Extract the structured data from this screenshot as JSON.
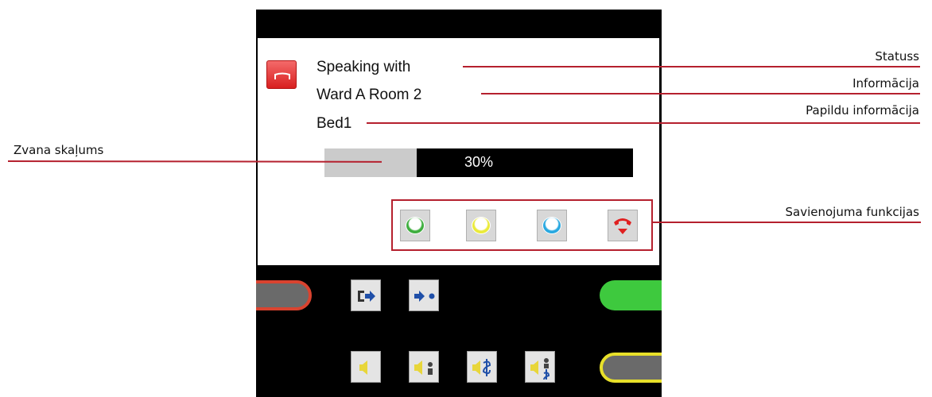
{
  "screen": {
    "status_text": "Speaking with",
    "info_text": "Ward A Room 2",
    "extra_info_text": "Bed1"
  },
  "volume": {
    "level_percent": 30,
    "label": "30%"
  },
  "connection_functions": [
    {
      "name": "green-call",
      "color": "#3fae3f"
    },
    {
      "name": "yellow-call",
      "color": "#eaea3a"
    },
    {
      "name": "blue-call",
      "color": "#29a8e0"
    },
    {
      "name": "hang-up",
      "color": "#e02020"
    }
  ],
  "annotations": {
    "status": "Statuss",
    "information": "Informācija",
    "extra_information": "Papildu informācija",
    "ring_volume": "Zvana skaļums",
    "connection_functions": "Savienojuma funkcijas"
  },
  "colors": {
    "accent": "#b5202e",
    "status_icon": "#e53935",
    "pill_red": "#d9432f",
    "pill_green": "#3ec93e",
    "pill_yellow": "#e8e02a"
  }
}
